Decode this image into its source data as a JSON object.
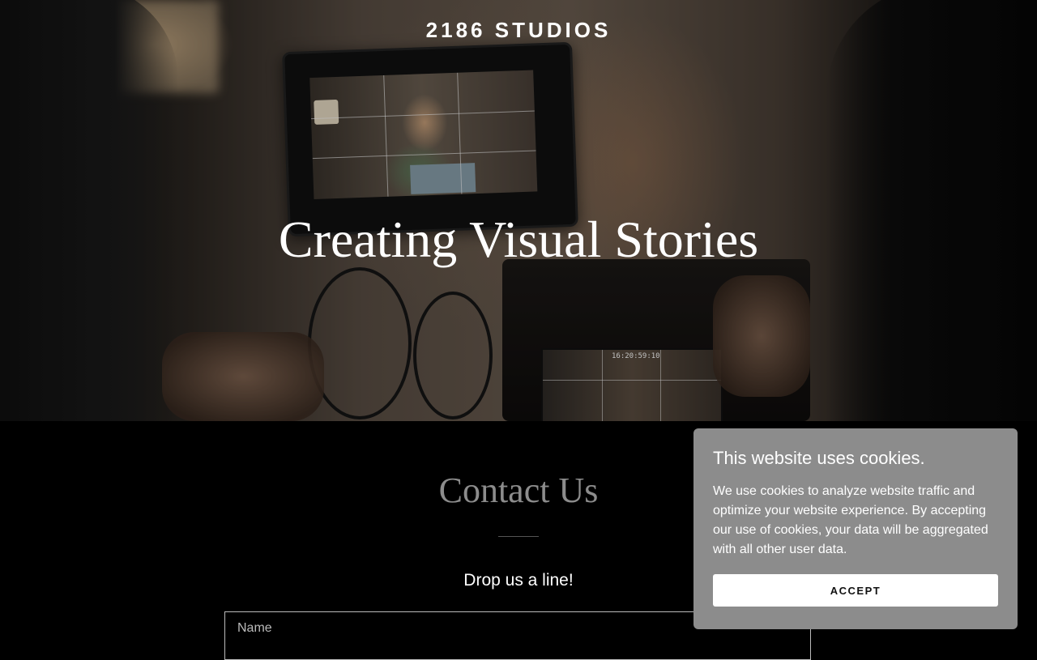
{
  "header": {
    "brand": "2186 STUDIOS"
  },
  "hero": {
    "headline": "Creating Visual Stories",
    "camera_timecode": "16:20:59:10"
  },
  "contact": {
    "title": "Contact Us",
    "subtitle": "Drop us a line!",
    "name_placeholder": "Name"
  },
  "cookie_banner": {
    "title": "This website uses cookies.",
    "text": "We use cookies to analyze website traffic and optimize your website experience. By accepting our use of cookies, your data will be aggregated with all other user data.",
    "accept_label": "ACCEPT"
  }
}
